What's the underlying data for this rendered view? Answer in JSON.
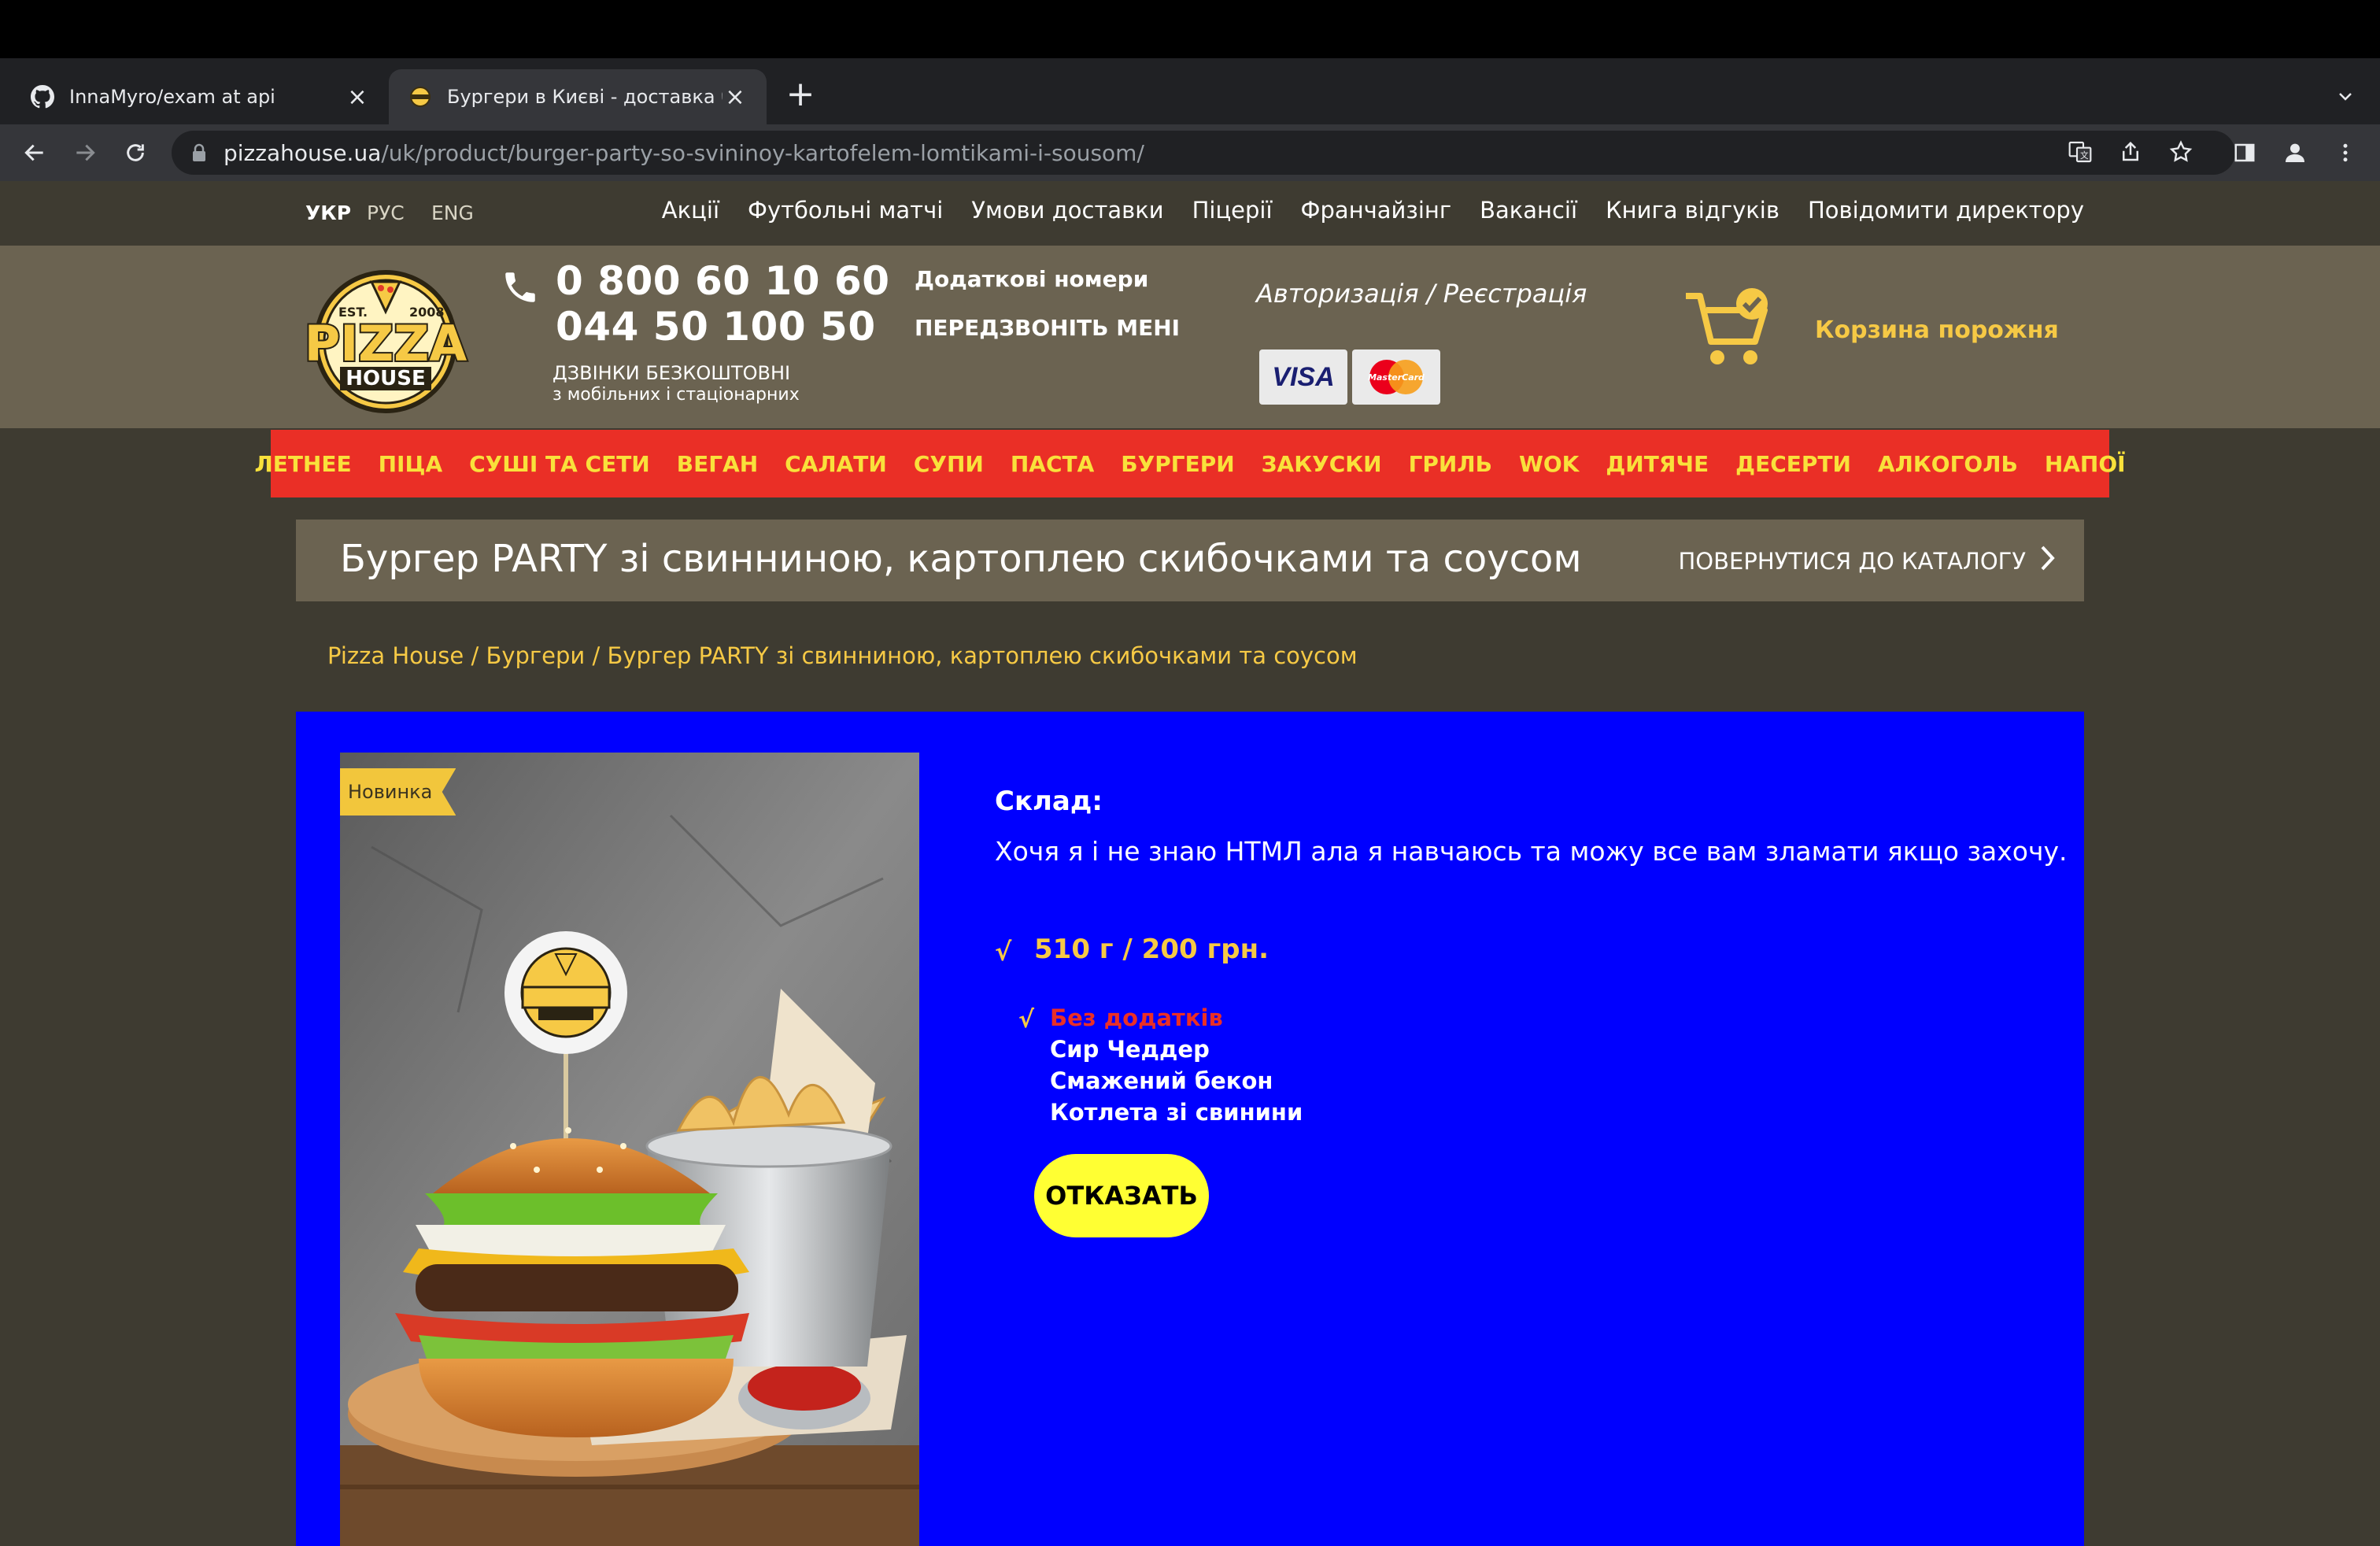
{
  "browser": {
    "tabs": [
      {
        "title": "InnaMyro/exam at api",
        "favicon": "github-icon"
      },
      {
        "title": "Бургери в Києві - доставка бургерів",
        "favicon": "pizzahouse-icon"
      }
    ],
    "url_host": "pizzahouse.ua",
    "url_path": "/uk/product/burger-party-so-svininoy-kartofelem-lomtikami-i-sousom/"
  },
  "site": {
    "languages": [
      "УКР",
      "РУС",
      "ENG"
    ],
    "active_language": "УКР",
    "top_nav": [
      "Акції",
      "Футбольні матчі",
      "Умови доставки",
      "Піцерії",
      "Франчайзінг",
      "Вакансії",
      "Книга відгуків",
      "Повідомити директору"
    ],
    "header": {
      "logo": {
        "est": "EST.",
        "year": "2008",
        "name": "PIZZA",
        "sub": "HOUSE"
      },
      "phone_1": "0 800 60 10 60",
      "phone_2": "044 50 100 50",
      "free_calls": "ДЗВІНКИ БЕЗКОШТОВНІ",
      "free_calls_sub": "з мобільних і стаціонарних",
      "extra_numbers": "Додаткові номери",
      "call_me": "ПЕРЕДЗВОНІТЬ МЕНІ",
      "auth": "Авторизація / Реєстрація",
      "visa": "VISA",
      "mastercard": "MasterCard",
      "cart": "Корзина порожня"
    },
    "categories": [
      "ЛЕТНЕЕ",
      "ПІЦА",
      "СУШІ ТА СЕТИ",
      "ВЕГАН",
      "САЛАТИ",
      "СУПИ",
      "ПАСТА",
      "БУРГЕРИ",
      "ЗАКУСКИ",
      "ГРИЛЬ",
      "WOK",
      "ДИТЯЧЕ",
      "ДЕСЕРТИ",
      "АЛКОГОЛЬ",
      "НАПОЇ"
    ]
  },
  "product": {
    "title": "Бургер PARTY зі свинниною, картоплею скибочками та соусом",
    "back_link": "ПОВЕРНУТИСЯ ДО КАТАЛОГУ",
    "breadcrumb": [
      "Pizza House",
      "Бургери",
      "Бургер PARTY зі свинниною, картоплею скибочками та соусом"
    ],
    "badge": "Новинка",
    "composition_label": "Склад:",
    "composition_text": "Хочя я і не знаю HTMЛ ала я навчаюсь та можу все вам зламати якщо захочу.",
    "check_mark": "√",
    "price": "510 г / 200 грн.",
    "options": [
      "Без додатків",
      "Сир Чеддер",
      "Смажений бекон",
      "Котлета зі свинини"
    ],
    "selected_option": "Без додатків",
    "refuse_button": "ОТКАЗАТЬ"
  },
  "colors": {
    "accent_yellow": "#f6c945",
    "menu_red": "#ea2f26",
    "product_blue": "#0000ff",
    "header_brown": "#6b6351"
  }
}
